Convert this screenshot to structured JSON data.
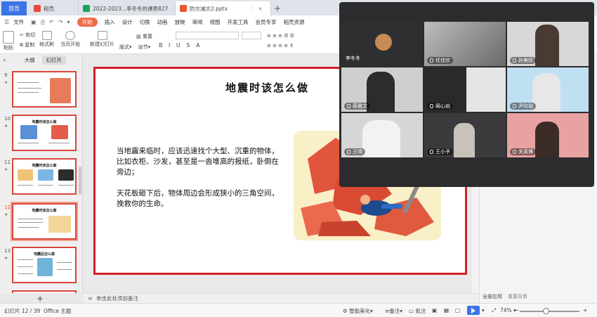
{
  "tabs": {
    "home": "首页",
    "items": [
      {
        "label": "稻壳",
        "color": "#e64b3c",
        "active": false
      },
      {
        "label": "2022-2023...李冬冬的课表827",
        "color": "#1aa260",
        "active": false
      },
      {
        "label": "防灾减灾2.pptx",
        "color": "#e8582c",
        "active": true
      }
    ],
    "add": "+"
  },
  "menu": {
    "file": "文件",
    "items": [
      "开始",
      "插入",
      "设计",
      "切换",
      "动画",
      "放映",
      "审阅",
      "视图",
      "开发工具",
      "会员专享",
      "稻壳资源"
    ]
  },
  "ribbon": {
    "paste": "粘贴",
    "cut": "剪切",
    "copy": "复制",
    "format_painter": "格式刷",
    "play_from_current": "当页开始",
    "new_slide": "新建幻灯片",
    "layout": "版式",
    "section": "节",
    "reset": "重置",
    "format_buttons": "B I U S A"
  },
  "left_panel": {
    "tab_outline": "大纲",
    "tab_slides": "幻灯片",
    "slides": [
      {
        "num": "9",
        "title": "",
        "current": false
      },
      {
        "num": "10",
        "title": "地震时该怎么做",
        "current": false
      },
      {
        "num": "11",
        "title": "地震时该怎么做",
        "current": false
      },
      {
        "num": "12",
        "title": "地震时该怎么做",
        "current": true
      },
      {
        "num": "13",
        "title": "地震后怎么做",
        "current": false
      }
    ],
    "add": "+"
  },
  "slide": {
    "title": "地震时该怎么做",
    "para1": "当地震来临时，应该迅速找个大型、沉重的物体，比如衣柜、沙发，甚至是一沓堆高的报纸，卧倒在旁边；",
    "para2": "天花板砸下后，物体周边会形成狭小的三角空间，挽救你的生命。"
  },
  "notes": {
    "placeholder": "单击此处添加备注"
  },
  "right_panel": {
    "apply_all": "全部应用",
    "reset_bg": "重置背景"
  },
  "video": {
    "participants": [
      {
        "name": "李冬冬",
        "avatar": true
      },
      {
        "name": "任佳欣",
        "avatar": false
      },
      {
        "name": "孙美欣",
        "avatar": false
      },
      {
        "name": "薛雅文",
        "avatar": false
      },
      {
        "name": "阚心焰",
        "avatar": false
      },
      {
        "name": "尹欣瑜",
        "avatar": false
      },
      {
        "name": "王晴",
        "avatar": false
      },
      {
        "name": "王小予",
        "avatar": false
      },
      {
        "name": "关英博",
        "avatar": false
      }
    ]
  },
  "status": {
    "slide_count": "幻灯片 12 / 39",
    "theme": "Office 主题",
    "smart_beautify": "智能美化",
    "notes": "备注",
    "comments": "批注",
    "zoom": "74%"
  },
  "colors": {
    "accent": "#3b74e6",
    "start_tab": "#f06d4a",
    "slide_border": "#d0202a"
  }
}
